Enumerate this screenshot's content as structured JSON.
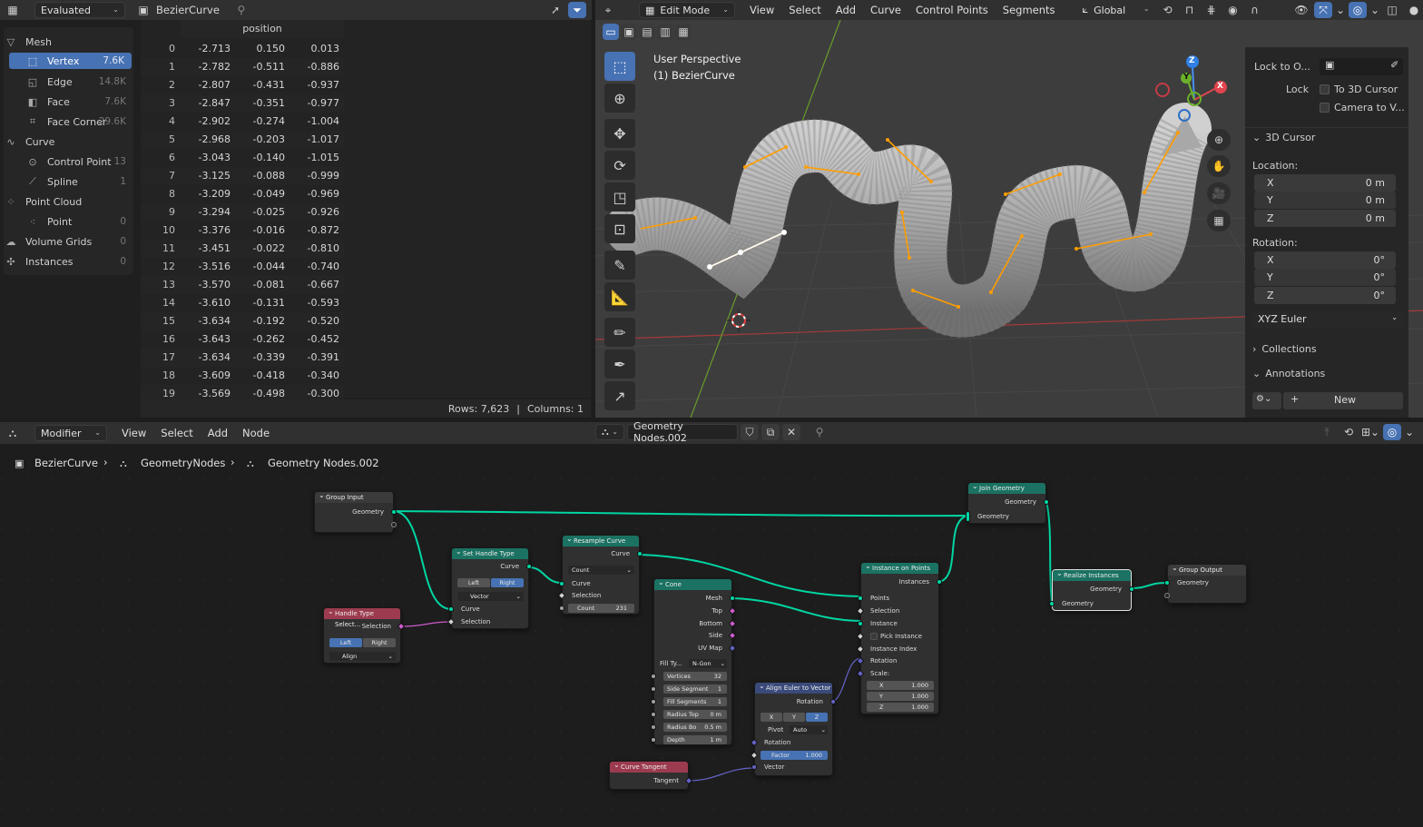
{
  "spreadsheet": {
    "header": {
      "mode": "Evaluated",
      "object": "BezierCurve"
    },
    "tree": [
      {
        "label": "Mesh",
        "count": "",
        "icon": "mesh-icon"
      },
      {
        "label": "Vertex",
        "count": "7.6K",
        "icon": "vertex-icon"
      },
      {
        "label": "Edge",
        "count": "14.8K",
        "icon": "edge-icon"
      },
      {
        "label": "Face",
        "count": "7.6K",
        "icon": "face-icon"
      },
      {
        "label": "Face Corner",
        "count": "29.6K",
        "icon": "face-corner-icon"
      },
      {
        "label": "Curve",
        "count": "",
        "icon": "curve-icon"
      },
      {
        "label": "Control Point",
        "count": "13",
        "icon": "control-point-icon"
      },
      {
        "label": "Spline",
        "count": "1",
        "icon": "spline-icon"
      },
      {
        "label": "Point Cloud",
        "count": "",
        "icon": "point-cloud-icon"
      },
      {
        "label": "Point",
        "count": "0",
        "icon": "point-icon"
      },
      {
        "label": "Volume Grids",
        "count": "0",
        "icon": "volume-icon"
      },
      {
        "label": "Instances",
        "count": "0",
        "icon": "instances-icon"
      }
    ],
    "column": "position",
    "rows": [
      [
        "0",
        "-2.713",
        "0.150",
        "0.013"
      ],
      [
        "1",
        "-2.782",
        "-0.511",
        "-0.886"
      ],
      [
        "2",
        "-2.807",
        "-0.431",
        "-0.937"
      ],
      [
        "3",
        "-2.847",
        "-0.351",
        "-0.977"
      ],
      [
        "4",
        "-2.902",
        "-0.274",
        "-1.004"
      ],
      [
        "5",
        "-2.968",
        "-0.203",
        "-1.017"
      ],
      [
        "6",
        "-3.043",
        "-0.140",
        "-1.015"
      ],
      [
        "7",
        "-3.125",
        "-0.088",
        "-0.999"
      ],
      [
        "8",
        "-3.209",
        "-0.049",
        "-0.969"
      ],
      [
        "9",
        "-3.294",
        "-0.025",
        "-0.926"
      ],
      [
        "10",
        "-3.376",
        "-0.016",
        "-0.872"
      ],
      [
        "11",
        "-3.451",
        "-0.022",
        "-0.810"
      ],
      [
        "12",
        "-3.516",
        "-0.044",
        "-0.740"
      ],
      [
        "13",
        "-3.570",
        "-0.081",
        "-0.667"
      ],
      [
        "14",
        "-3.610",
        "-0.131",
        "-0.593"
      ],
      [
        "15",
        "-3.634",
        "-0.192",
        "-0.520"
      ],
      [
        "16",
        "-3.643",
        "-0.262",
        "-0.452"
      ],
      [
        "17",
        "-3.634",
        "-0.339",
        "-0.391"
      ],
      [
        "18",
        "-3.609",
        "-0.418",
        "-0.340"
      ],
      [
        "19",
        "-3.569",
        "-0.498",
        "-0.300"
      ]
    ],
    "status": {
      "rows": "Rows: 7,623",
      "sep": "|",
      "columns": "Columns: 1"
    }
  },
  "viewport": {
    "mode": "Edit Mode",
    "menus": [
      "View",
      "Select",
      "Add",
      "Curve",
      "Control Points",
      "Segments"
    ],
    "orientation": "Global",
    "overlay_title": "User Perspective",
    "overlay_object": "(1) BezierCurve",
    "gizmo": {
      "x": "X",
      "y": "Y",
      "z": "Z"
    }
  },
  "npanel": {
    "lock_to": "Lock to O...",
    "lock": "Lock",
    "to_cursor": "To 3D Cursor",
    "camera_to": "Camera to V...",
    "cursor_section": "3D Cursor",
    "location": "Location:",
    "loc": [
      {
        "axis": "X",
        "val": "0 m"
      },
      {
        "axis": "Y",
        "val": "0 m"
      },
      {
        "axis": "Z",
        "val": "0 m"
      }
    ],
    "rotation": "Rotation:",
    "rot": [
      {
        "axis": "X",
        "val": "0°"
      },
      {
        "axis": "Y",
        "val": "0°"
      },
      {
        "axis": "Z",
        "val": "0°"
      }
    ],
    "rot_mode": "XYZ Euler",
    "collections": "Collections",
    "annotations": "Annotations",
    "new": "New"
  },
  "node_editor": {
    "type": "Modifier",
    "menus": [
      "View",
      "Select",
      "Add",
      "Node"
    ],
    "tree_name": "Geometry Nodes.002",
    "breadcrumb": [
      "BezierCurve",
      "GeometryNodes",
      "Geometry Nodes.002"
    ],
    "nodes": {
      "group_input": {
        "title": "Group Input",
        "out": "Geometry"
      },
      "handle_sel": {
        "title": "Handle Type Select...",
        "out": "Selection",
        "left": "Left",
        "right": "Right",
        "mode": "Align"
      },
      "set_handle": {
        "title": "Set Handle Type",
        "out": "Curve",
        "left": "Left",
        "right": "Right",
        "mode": "Vector",
        "in_curve": "Curve",
        "in_sel": "Selection"
      },
      "resample": {
        "title": "Resample Curve",
        "out": "Curve",
        "mode": "Count",
        "in_curve": "Curve",
        "in_sel": "Selection",
        "count_label": "Count",
        "count": "231"
      },
      "cone": {
        "title": "Cone",
        "outs": [
          "Mesh",
          "Top",
          "Bottom",
          "Side",
          "UV Map"
        ],
        "fill_label": "Fill Ty...",
        "fill": "N-Gon",
        "fields": [
          {
            "l": "Vertices",
            "v": "32"
          },
          {
            "l": "Side Segment",
            "v": "1"
          },
          {
            "l": "Fill Segments",
            "v": "1"
          },
          {
            "l": "Radius Top",
            "v": "0 m"
          },
          {
            "l": "Radius Bo",
            "v": "0.5 m"
          },
          {
            "l": "Depth",
            "v": "1 m"
          }
        ]
      },
      "align": {
        "title": "Align Euler to Vector",
        "out": "Rotation",
        "axes": [
          "X",
          "Y",
          "Z"
        ],
        "pivot_label": "Pivot",
        "pivot": "Auto",
        "in_rot": "Rotation",
        "factor_label": "Factor",
        "factor": "1.000",
        "in_vec": "Vector"
      },
      "tangent": {
        "title": "Curve Tangent",
        "out": "Tangent"
      },
      "iop": {
        "title": "Instance on Points",
        "out": "Instances",
        "ins": [
          "Points",
          "Selection",
          "Instance",
          "Pick Instance",
          "Instance Index",
          "Rotation",
          "Scale:"
        ],
        "scale": [
          {
            "a": "X",
            "v": "1.000"
          },
          {
            "a": "Y",
            "v": "1.000"
          },
          {
            "a": "Z",
            "v": "1.000"
          }
        ]
      },
      "join": {
        "title": "Join Geometry",
        "out": "Geometry",
        "in": "Geometry"
      },
      "realize": {
        "title": "Realize Instances",
        "out": "Geometry",
        "in": "Geometry"
      },
      "output": {
        "title": "Group Output",
        "in": "Geometry"
      }
    }
  },
  "colors": {
    "accent": "#4772b3",
    "geometry_node": "#1b7262",
    "input_node": "#9c3b4f",
    "geometry_socket": "#00d6a3",
    "curve_orange": "#ffa000"
  }
}
